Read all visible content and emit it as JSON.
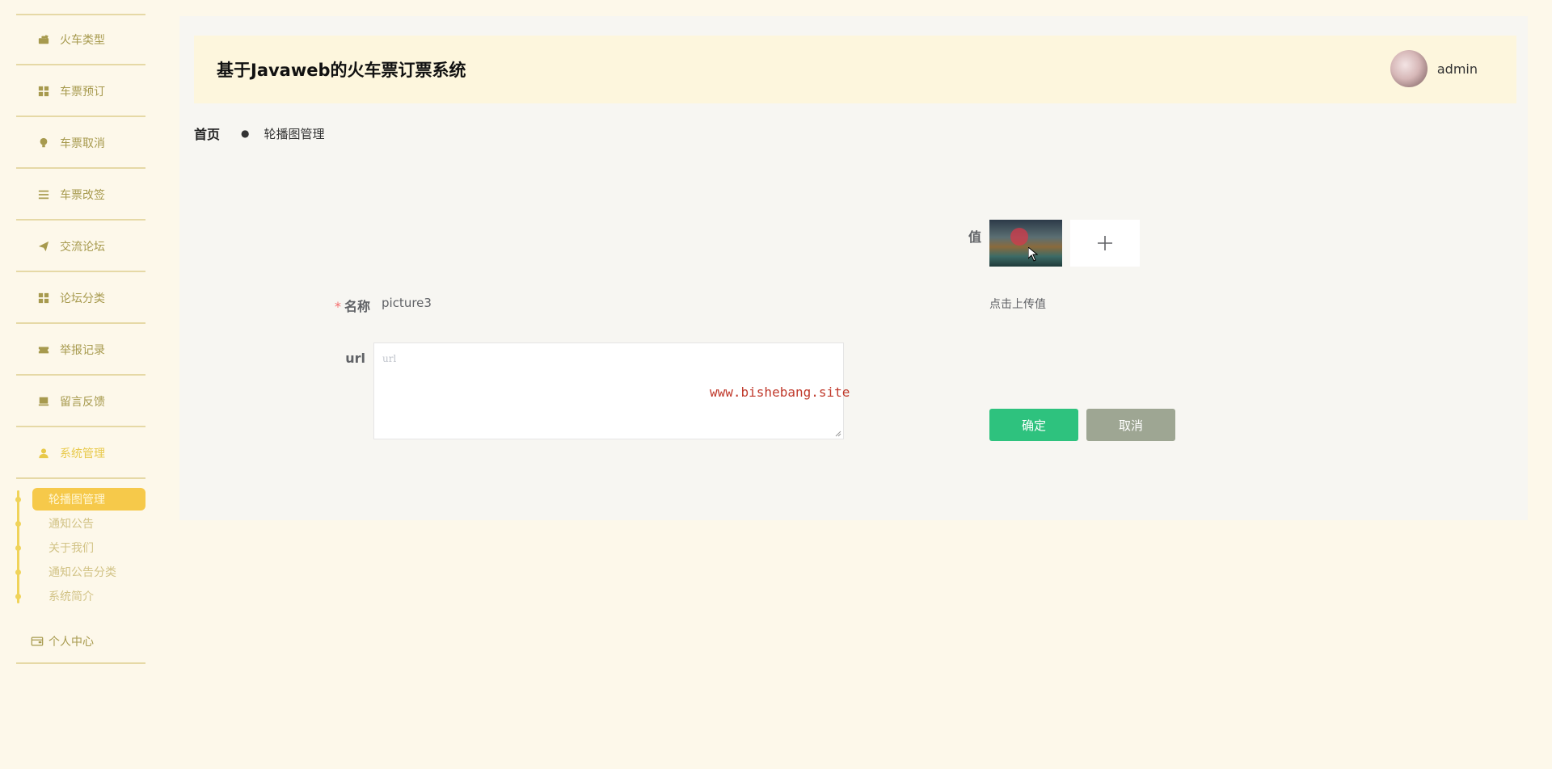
{
  "sidebar": {
    "items": [
      {
        "label": "火车类型",
        "icon": "briefcase-icon"
      },
      {
        "label": "车票预订",
        "icon": "grid-icon"
      },
      {
        "label": "车票取消",
        "icon": "bulb-icon"
      },
      {
        "label": "车票改签",
        "icon": "list-icon"
      },
      {
        "label": "交流论坛",
        "icon": "paper-plane-icon"
      },
      {
        "label": "论坛分类",
        "icon": "grid-icon"
      },
      {
        "label": "举报记录",
        "icon": "ticket-icon"
      },
      {
        "label": "留言反馈",
        "icon": "monitor-icon"
      },
      {
        "label": "系统管理",
        "icon": "user-icon"
      }
    ],
    "submenu": [
      {
        "label": "轮播图管理",
        "active": true
      },
      {
        "label": "通知公告"
      },
      {
        "label": "关于我们"
      },
      {
        "label": "通知公告分类"
      },
      {
        "label": "系统简介"
      }
    ],
    "user_center": {
      "label": "个人中心",
      "icon": "wallet-icon"
    }
  },
  "header": {
    "title": "基于Javaweb的火车票订票系统",
    "username": "admin"
  },
  "breadcrumb": {
    "home": "首页",
    "separator": "●",
    "current": "轮播图管理"
  },
  "form": {
    "name_label": "名称",
    "name_required_mark": "*",
    "name_value": "picture3",
    "url_label": "url",
    "url_placeholder": "url",
    "value_label": "值",
    "upload_tip": "点击上传值",
    "confirm_label": "确定",
    "cancel_label": "取消"
  },
  "watermark": "www.bishebang.site",
  "colors": {
    "page_bg": "#fdf8ea",
    "accent": "#f6c94a",
    "confirm": "#2ec27e",
    "cancel": "#9ea693",
    "menu_text": "#a79a4e"
  }
}
